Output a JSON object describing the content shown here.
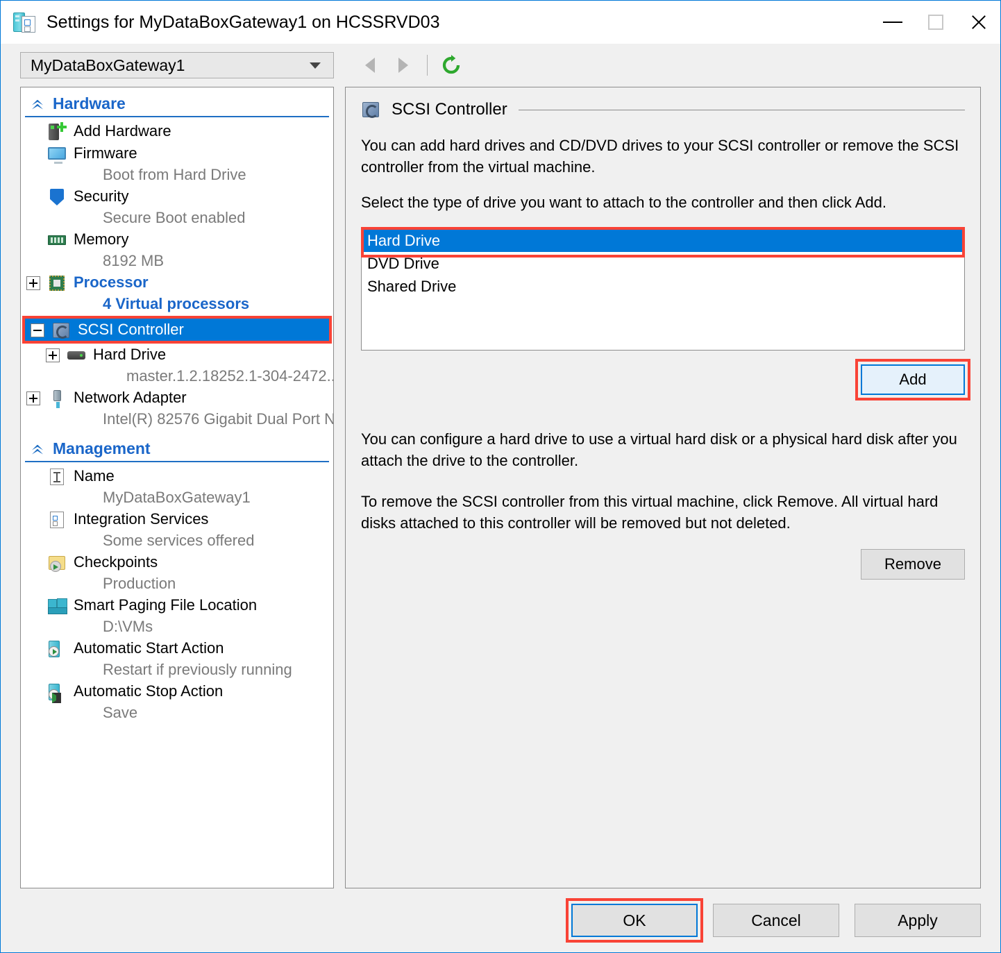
{
  "window": {
    "title": "Settings for MyDataBoxGateway1 on HCSSRVD03",
    "icon": "vm-settings-icon",
    "controls": {
      "minimize": "minimize",
      "maximize": "maximize",
      "close": "close"
    }
  },
  "toolbar": {
    "vm_selector_value": "MyDataBoxGateway1",
    "back": "back",
    "forward": "forward",
    "refresh": "refresh"
  },
  "sidebar": {
    "groups": [
      {
        "label": "Hardware",
        "items": [
          {
            "label": "Add Hardware",
            "sub": "",
            "icon": "add-hardware-icon",
            "expander": "none"
          },
          {
            "label": "Firmware",
            "sub": "Boot from Hard Drive",
            "icon": "firmware-icon",
            "expander": "none"
          },
          {
            "label": "Security",
            "sub": "Secure Boot enabled",
            "icon": "security-icon",
            "expander": "none"
          },
          {
            "label": "Memory",
            "sub": "8192 MB",
            "icon": "memory-icon",
            "expander": "none"
          },
          {
            "label": "Processor",
            "sub": "4 Virtual processors",
            "icon": "processor-icon",
            "expander": "plus"
          },
          {
            "label": "SCSI Controller",
            "sub": "",
            "icon": "scsi-controller-icon",
            "expander": "minus"
          },
          {
            "label": "Hard Drive",
            "sub": "master.1.2.18252.1-304-2472...",
            "icon": "hard-drive-icon",
            "expander": "plus"
          },
          {
            "label": "Network Adapter",
            "sub": "Intel(R) 82576 Gigabit Dual Port N...",
            "icon": "network-adapter-icon",
            "expander": "plus"
          }
        ]
      },
      {
        "label": "Management",
        "items": [
          {
            "label": "Name",
            "sub": "MyDataBoxGateway1",
            "icon": "name-icon",
            "expander": "none"
          },
          {
            "label": "Integration Services",
            "sub": "Some services offered",
            "icon": "integration-services-icon",
            "expander": "none"
          },
          {
            "label": "Checkpoints",
            "sub": "Production",
            "icon": "checkpoints-icon",
            "expander": "none"
          },
          {
            "label": "Smart Paging File Location",
            "sub": "D:\\VMs",
            "icon": "smart-paging-icon",
            "expander": "none"
          },
          {
            "label": "Automatic Start Action",
            "sub": "Restart if previously running",
            "icon": "automatic-start-icon",
            "expander": "none"
          },
          {
            "label": "Automatic Stop Action",
            "sub": "Save",
            "icon": "automatic-stop-icon",
            "expander": "none"
          }
        ]
      }
    ]
  },
  "main": {
    "title": "SCSI Controller",
    "paragraph1": "You can add hard drives and CD/DVD drives to your SCSI controller or remove the SCSI controller from the virtual machine.",
    "paragraph2": "Select the type of drive you want to attach to the controller and then click Add.",
    "drive_types": [
      "Hard Drive",
      "DVD Drive",
      "Shared Drive"
    ],
    "selected_drive_type": "Hard Drive",
    "add_label": "Add",
    "paragraph3": "You can configure a hard drive to use a virtual hard disk or a physical hard disk after you attach the drive to the controller.",
    "paragraph4": "To remove the SCSI controller from this virtual machine, click Remove. All virtual hard disks attached to this controller will be removed but not deleted.",
    "remove_label": "Remove"
  },
  "footer": {
    "ok": "OK",
    "cancel": "Cancel",
    "apply": "Apply"
  },
  "colors": {
    "selection_blue": "#0078D7",
    "annotation_red": "#F94336",
    "link_blue": "#1A66C9",
    "refresh_green": "#2EA82E"
  }
}
